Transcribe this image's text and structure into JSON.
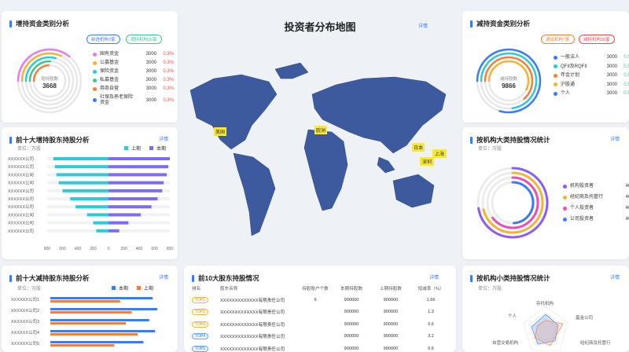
{
  "map": {
    "title": "投资者分布地图",
    "detail": "详情",
    "labels": [
      "美国",
      "欧洲",
      "日本",
      "上海",
      "深圳"
    ]
  },
  "inc_type": {
    "title": "增持资金类别分析",
    "pills": [
      "新进机构7家",
      "增持机构26家"
    ],
    "center_label": "增持股数",
    "center_value": "3668",
    "items": [
      {
        "name": "国有资金",
        "value": "3000",
        "pct": "0.3%",
        "color": "#e879f0"
      },
      {
        "name": "公募基金",
        "value": "3000",
        "pct": "0.3%",
        "color": "#f7b234"
      },
      {
        "name": "保险资金",
        "value": "3000",
        "pct": "0.3%",
        "color": "#2ccbd6"
      },
      {
        "name": "私募基金",
        "value": "3000",
        "pct": "0.3%",
        "color": "#3fc78a"
      },
      {
        "name": "券商自营",
        "value": "3000",
        "pct": "0.3%",
        "color": "#f0803c"
      },
      {
        "name": "社保及养老保险资金",
        "value": "3000",
        "pct": "0.3%",
        "color": "#3a7bf6"
      }
    ]
  },
  "dec_type": {
    "title": "减持资金类别分析",
    "pills": [
      "退出机构7家",
      "减持机构38家"
    ],
    "center_label": "减持股数",
    "center_value": "9866",
    "items": [
      {
        "name": "一般法人",
        "value": "3000",
        "pct": "0.5%",
        "color": "#3a7bf6"
      },
      {
        "name": "QFII及RQFII",
        "value": "3000",
        "pct": "0.5%",
        "color": "#2ccbd6"
      },
      {
        "name": "年金计划",
        "value": "3000",
        "pct": "0.5%",
        "color": "#f0803c"
      },
      {
        "name": "沪股通",
        "value": "3000",
        "pct": "0.5%",
        "color": "#f7b234"
      },
      {
        "name": "个人",
        "value": "3000",
        "pct": "0.5%",
        "color": "#3a7bf6"
      }
    ]
  },
  "top_inc": {
    "title": "前十大增持股东持股分析",
    "detail": "详情",
    "unit": "单位：万股",
    "legend": [
      "上期",
      "本期"
    ],
    "companies": [
      "XXXXXX公司",
      "XXXXXX公司",
      "XXXXXX公司",
      "XXXXXX公司",
      "XXXXXX公司",
      "XXXXXX公司",
      "XXXXXX公司",
      "XXXXXX公司",
      "XXXXXX公司",
      "XXXXXX公司"
    ],
    "xticks": [
      "800",
      "600",
      "400",
      "200",
      "0",
      "200",
      "400",
      "600",
      "800"
    ]
  },
  "inst_large": {
    "title": "按机构大类持股情况统计",
    "detail": "详情",
    "unit": "单位：万股",
    "items": [
      {
        "name": "机构投资者",
        "value": "4000",
        "color": "#8b5cf6"
      },
      {
        "name": "经纪商及托管行",
        "value": "4000",
        "color": "#f7b234"
      },
      {
        "name": "个人投资者",
        "value": "4000",
        "color": "#e84fb5"
      },
      {
        "name": "公司投资者",
        "value": "4000",
        "color": "#3a7bf6"
      }
    ]
  },
  "top_dec": {
    "title": "前十大减持股东持股分析",
    "detail": "详情",
    "unit": "单位：万股",
    "legend": [
      "本期",
      "上期"
    ],
    "companies": [
      "XXXXXX公司1",
      "XXXXXX公司2",
      "XXXXXX公司3",
      "XXXXXX公司4",
      "XXXXXX公司5"
    ]
  },
  "top10": {
    "title": "前10大股东持股情况",
    "detail": "详情",
    "headers": [
      "排名",
      "股东名称",
      "持股账户个数",
      "本期持股数",
      "上期持股数",
      "增减率（%）"
    ],
    "rows": [
      {
        "rank": "TOP1",
        "name": "XXXXXXXXXXXXX有限责任公司",
        "accounts": "6",
        "cur": "900000",
        "prev": "900000",
        "rate": "1.66"
      },
      {
        "rank": "TOP2",
        "name": "XXXXXXXXXXXXX有限责任公司",
        "accounts": "",
        "cur": "900000",
        "prev": "900000",
        "rate": "1.3"
      },
      {
        "rank": "TOP3",
        "name": "XXXXXXXXXXXXX有限责任公司",
        "accounts": "",
        "cur": "900000",
        "prev": "900000",
        "rate": "0.6"
      },
      {
        "rank": "TOP4",
        "name": "XXXXXXXXXXXXX有限责任公司",
        "accounts": "",
        "cur": "900000",
        "prev": "900000",
        "rate": "3.2"
      },
      {
        "rank": "TOP5",
        "name": "XXXXXXXXXXXXX有限责任公司",
        "accounts": "",
        "cur": "900000",
        "prev": "900000",
        "rate": "0.6"
      }
    ]
  },
  "inst_small": {
    "title": "按机构小类持股情况统计",
    "detail": "详情",
    "unit": "单位：万股",
    "axes": [
      "存托机构",
      "基金公司",
      "经纪商及托管行",
      "自营交易机构",
      "个人"
    ]
  },
  "chart_data": [
    {
      "type": "bar",
      "name": "top_inc",
      "categories": [
        "XXXXXX公司",
        "XXXXXX公司",
        "XXXXXX公司",
        "XXXXXX公司",
        "XXXXXX公司",
        "XXXXXX公司",
        "XXXXXX公司",
        "XXXXXX公司",
        "XXXXXX公司",
        "XXXXXX公司"
      ],
      "series": [
        {
          "name": "上期",
          "values": [
            720,
            700,
            680,
            650,
            600,
            500,
            430,
            280,
            200,
            160
          ]
        },
        {
          "name": "本期",
          "values": [
            800,
            780,
            760,
            720,
            700,
            640,
            560,
            420,
            260,
            140
          ]
        }
      ],
      "xlim": [
        -800,
        800
      ]
    },
    {
      "type": "bar",
      "name": "top_dec",
      "categories": [
        "XXXXXX公司1",
        "XXXXXX公司2",
        "XXXXXX公司3",
        "XXXXXX公司4",
        "XXXXXX公司5"
      ],
      "series": [
        {
          "name": "本期",
          "values": [
            0.88,
            0.92,
            0.85,
            0.9,
            0.8
          ]
        },
        {
          "name": "上期",
          "values": [
            0.6,
            0.7,
            0.65,
            0.75,
            0.55
          ]
        }
      ]
    }
  ]
}
